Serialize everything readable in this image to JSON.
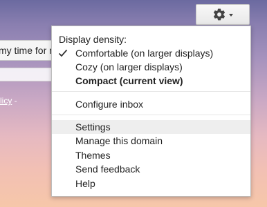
{
  "background": {
    "search_text": "my time for n",
    "link_text": "licy",
    "link_suffix": " -"
  },
  "toolbar": {
    "gear_icon": "gear-icon",
    "caret_icon": "chevron-down-icon"
  },
  "menu": {
    "density_heading": "Display density:",
    "density_options": [
      {
        "label": "Comfortable (on larger displays)",
        "checked": true
      },
      {
        "label": "Cozy (on larger displays)",
        "checked": false
      },
      {
        "label": "Compact (current view)",
        "checked": false,
        "bold": true
      }
    ],
    "configure_inbox": "Configure inbox",
    "items": [
      {
        "label": "Settings",
        "highlighted": true
      },
      {
        "label": "Manage this domain"
      },
      {
        "label": "Themes"
      },
      {
        "label": "Send feedback"
      },
      {
        "label": "Help"
      }
    ]
  },
  "colors": {
    "accent_highlight": "#eeeeee",
    "menu_border": "#bdbdbd"
  }
}
